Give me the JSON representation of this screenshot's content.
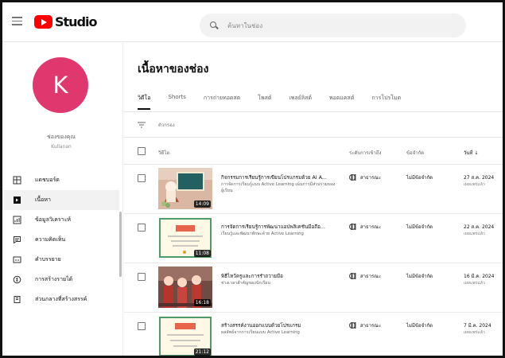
{
  "app": {
    "brand": "Studio",
    "search_placeholder": "ค้นหาในช่อง"
  },
  "channel": {
    "avatar_letter": "K",
    "avatar_color": "#e1376f",
    "name": "ช่องของคุณ",
    "subtitle": "Kullanan"
  },
  "sidebar": {
    "items": [
      {
        "label": "แดชบอร์ด",
        "icon": "dashboard-icon"
      },
      {
        "label": "เนื้อหา",
        "icon": "content-icon",
        "active": true
      },
      {
        "label": "ข้อมูลวิเคราะห์",
        "icon": "analytics-icon"
      },
      {
        "label": "ความคิดเห็น",
        "icon": "comments-icon"
      },
      {
        "label": "คำบรรยาย",
        "icon": "subtitles-icon"
      },
      {
        "label": "การสร้างรายได้",
        "icon": "monetization-icon"
      },
      {
        "label": "ส่วนกลางที่สร้างสรรค์",
        "icon": "library-icon"
      }
    ]
  },
  "main": {
    "title": "เนื้อหาของช่อง",
    "tabs": [
      {
        "label": "วิดีโอ",
        "active": true
      },
      {
        "label": "Shorts"
      },
      {
        "label": "การถ่ายทอดสด"
      },
      {
        "label": "โพสต์"
      },
      {
        "label": "เพลย์ลิสต์"
      },
      {
        "label": "พอดแคสต์"
      },
      {
        "label": "การโปรโมต"
      }
    ],
    "filter_label": "ตัวกรอง",
    "table_headers": {
      "video": "วิดีโอ",
      "visibility": "ระดับการเข้าถึง",
      "restrictions": "ข้อจำกัด",
      "date": "วันที่"
    },
    "rows": [
      {
        "title": "กิจกรรมการเรียนรู้การเขียนโปรแกรมด้วย AI A...",
        "description": "การจัดการเรียนรู้แบบ Active Learning เน้นการมีส่วนร่วมของผู้เรียน",
        "duration": "14:09",
        "visibility": "สาธารณะ",
        "restriction": "ไม่มีข้อจำกัด",
        "date": "27 ส.ค. 2024",
        "date_status": "เผยแพร่แล้ว",
        "thumb": "A"
      },
      {
        "title": "การจัดการเรียนรู้การพัฒนาแอปพลิเคชันมือถือ...",
        "description": "เรียนรู้และพัฒนาทักษะด้วย Active Learning",
        "duration": "11:08",
        "visibility": "สาธารณะ",
        "restriction": "ไม่มีข้อจำกัด",
        "date": "22 ส.ค. 2024",
        "date_status": "เผยแพร่แล้ว",
        "thumb": "B"
      },
      {
        "title": "พิธีไหว้ครูและการรำถวายมือ",
        "description": "ช่วงเวลาสำคัญของนักเรียน",
        "duration": "16:18",
        "visibility": "สาธารณะ",
        "restriction": "ไม่มีข้อจำกัด",
        "date": "16 มี.ค. 2024",
        "date_status": "เผยแพร่แล้ว",
        "thumb": "C"
      },
      {
        "title": "สร้างสรรค์งานออกแบบด้วยโปรแกรม",
        "description": "ผลลัพธ์จากการเรียนแบบ Active Learning",
        "duration": "21:12",
        "visibility": "สาธารณะ",
        "restriction": "ไม่มีข้อจำกัด",
        "date": "7 มี.ค. 2024",
        "date_status": "เผยแพร่แล้ว",
        "thumb": "B"
      }
    ]
  }
}
